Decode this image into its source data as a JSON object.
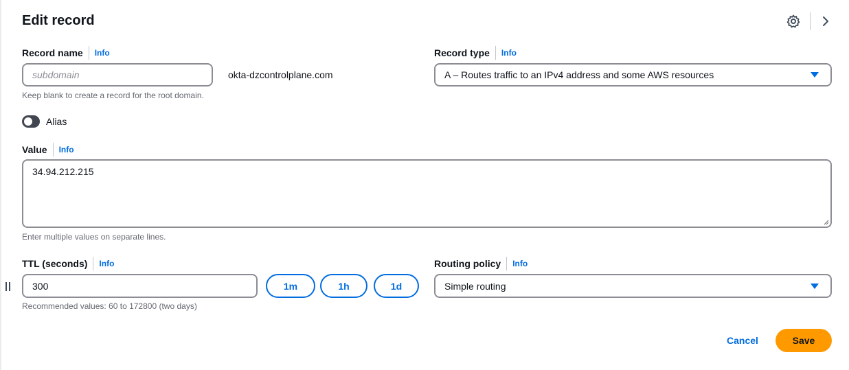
{
  "header": {
    "title": "Edit record",
    "settings_icon": "gear-icon",
    "collapse_icon": "chevron-right-icon"
  },
  "record_name": {
    "label": "Record name",
    "info": "Info",
    "value": "",
    "placeholder": "subdomain",
    "domain_suffix": "okta-dzcontrolplane.com",
    "hint": "Keep blank to create a record for the root domain."
  },
  "record_type": {
    "label": "Record type",
    "info": "Info",
    "selected": "A – Routes traffic to an IPv4 address and some AWS resources"
  },
  "alias": {
    "label": "Alias",
    "enabled": false
  },
  "value": {
    "label": "Value",
    "info": "Info",
    "text": "34.94.212.215",
    "hint": "Enter multiple values on separate lines."
  },
  "ttl": {
    "label": "TTL (seconds)",
    "info": "Info",
    "value": "300",
    "presets": [
      "1m",
      "1h",
      "1d"
    ],
    "hint": "Recommended values: 60 to 172800 (two days)"
  },
  "routing_policy": {
    "label": "Routing policy",
    "info": "Info",
    "selected": "Simple routing"
  },
  "actions": {
    "cancel": "Cancel",
    "save": "Save"
  },
  "colors": {
    "accent": "#006ce0",
    "primary_button": "#ff9900",
    "border": "#8c8c94"
  }
}
